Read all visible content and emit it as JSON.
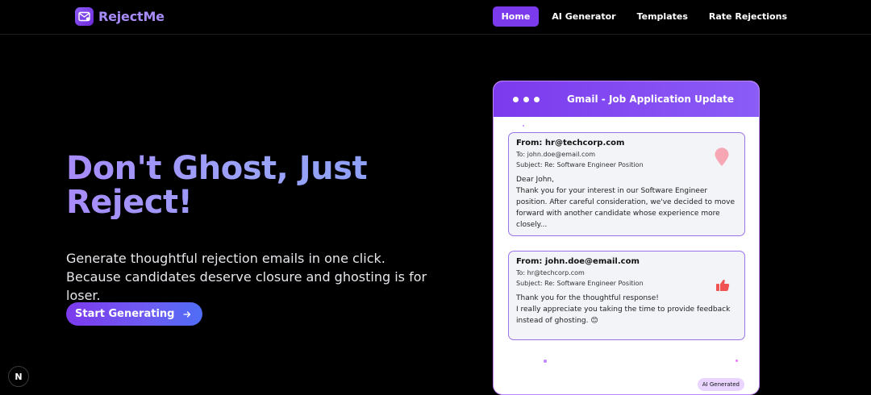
{
  "brand": {
    "name": "RejectMe",
    "logo_icon": "mail-icon"
  },
  "nav": {
    "items": [
      {
        "label": "Home",
        "active": true
      },
      {
        "label": "AI Generator",
        "active": false
      },
      {
        "label": "Templates",
        "active": false
      },
      {
        "label": "Rate Rejections",
        "active": false
      }
    ]
  },
  "hero": {
    "title": "Don't Ghost, Just Reject!",
    "subtitle": "Generate thoughtful rejection emails in one click. Because candidates deserve closure and ghosting is for loser.",
    "cta_label": "Start Generating",
    "cta_icon": "arrow-right-icon"
  },
  "window": {
    "title": "Gmail - Job Application Update",
    "emails": [
      {
        "from": "From: hr@techcorp.com",
        "to": "To: john.doe@email.com",
        "subject": "Subject: Re: Software Engineer Position",
        "body": "Dear John,\nThank you for your interest in our Software Engineer position. After careful consideration, we've decided to move forward with another candidate whose experience more closely...",
        "icon": "map-pin-icon"
      },
      {
        "from": "From: john.doe@email.com",
        "to": "To: hr@techcorp.com",
        "subject": "Subject: Re: Software Engineer Position",
        "body": "Thank you for the thoughtful response!\nI really appreciate you taking the time to provide feedback instead of ghosting. 😊",
        "icon": "thumbs-up-icon"
      }
    ],
    "badge": "AI Generated"
  },
  "indicator": {
    "label": "N"
  },
  "colors": {
    "accent": "#7c3aed",
    "background": "#000000",
    "title_gradient_start": "#a78bfa",
    "card_border": "#9b73e8"
  }
}
